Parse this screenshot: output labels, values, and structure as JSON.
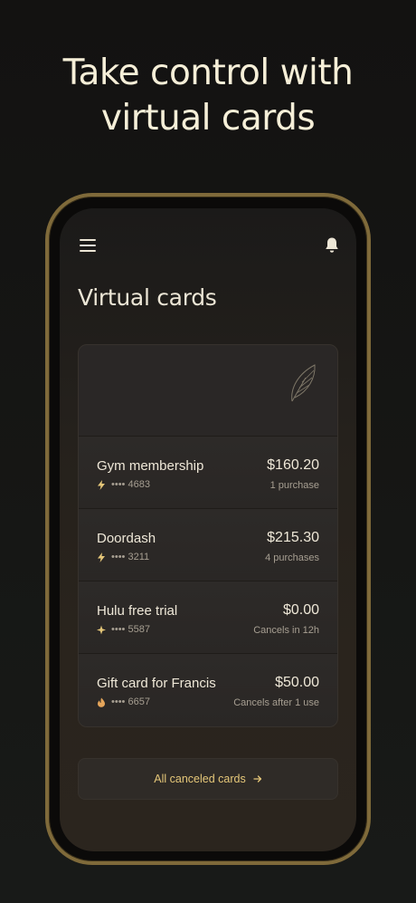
{
  "headline": {
    "line1": "Take control with",
    "line2": "virtual cards"
  },
  "app": {
    "title": "Virtual cards"
  },
  "colors": {
    "accent": "#e5c779",
    "phone_frame": "#7f6a3a",
    "text_primary": "#efe8d8",
    "text_secondary": "#a79f92"
  },
  "cards": [
    {
      "name": "Gym membership",
      "icon": "bolt-icon",
      "masked": "•••• 4683",
      "amount": "$160.20",
      "status": "1 purchase"
    },
    {
      "name": "Doordash",
      "icon": "bolt-icon",
      "masked": "•••• 3211",
      "amount": "$215.30",
      "status": "4 purchases"
    },
    {
      "name": "Hulu free trial",
      "icon": "sparkle-icon",
      "masked": "•••• 5587",
      "amount": "$0.00",
      "status": "Cancels in 12h"
    },
    {
      "name": "Gift card for Francis",
      "icon": "flame-icon",
      "masked": "•••• 6657",
      "amount": "$50.00",
      "status": "Cancels after 1 use"
    }
  ],
  "cta": {
    "label": "All canceled cards"
  }
}
